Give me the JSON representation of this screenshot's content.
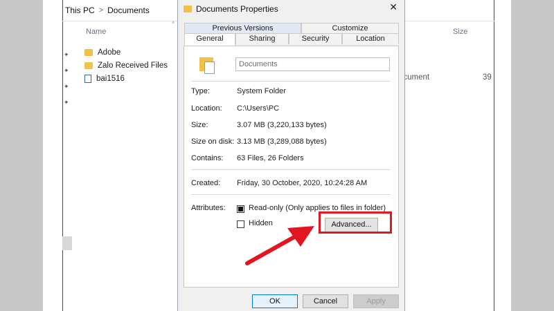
{
  "explorer": {
    "breadcrumb": [
      "This PC",
      "Documents"
    ],
    "columns": {
      "name": "Name",
      "size": "Size"
    },
    "files": [
      {
        "name": "Adobe",
        "icon": "folder-icon"
      },
      {
        "name": "Zalo Received Files",
        "icon": "folder-icon"
      },
      {
        "name": "bai1516",
        "icon": "word-document-icon"
      }
    ],
    "partial_type": "ocument",
    "partial_size": "39"
  },
  "dialog": {
    "title": "Documents Properties",
    "close_glyph": "✕",
    "tabs_top": [
      "Previous Versions",
      "Customize"
    ],
    "tabs_bottom": [
      "General",
      "Sharing",
      "Security",
      "Location"
    ],
    "folder_name": "Documents",
    "props": {
      "type_label": "Type:",
      "type_value": "System Folder",
      "location_label": "Location:",
      "location_value": "C:\\Users\\PC",
      "size_label": "Size:",
      "size_value": "3.07 MB (3,220,133 bytes)",
      "size_on_disk_label": "Size on disk:",
      "size_on_disk_value": "3.13 MB (3,289,088 bytes)",
      "contains_label": "Contains:",
      "contains_value": "63 Files, 26 Folders",
      "created_label": "Created:",
      "created_value": "Friday, 30 October, 2020, 10:24:28 AM",
      "attributes_label": "Attributes:"
    },
    "attributes": {
      "readonly_label": "Read-only (Only applies to files in folder)",
      "readonly_checked": true,
      "hidden_label": "Hidden",
      "hidden_checked": false
    },
    "advanced_label": "Advanced...",
    "buttons": {
      "ok": "OK",
      "cancel": "Cancel",
      "apply": "Apply"
    }
  },
  "colors": {
    "highlight_red": "#e2161f",
    "folder_yellow": "#f0c24b",
    "ok_blue": "#0078d7"
  }
}
